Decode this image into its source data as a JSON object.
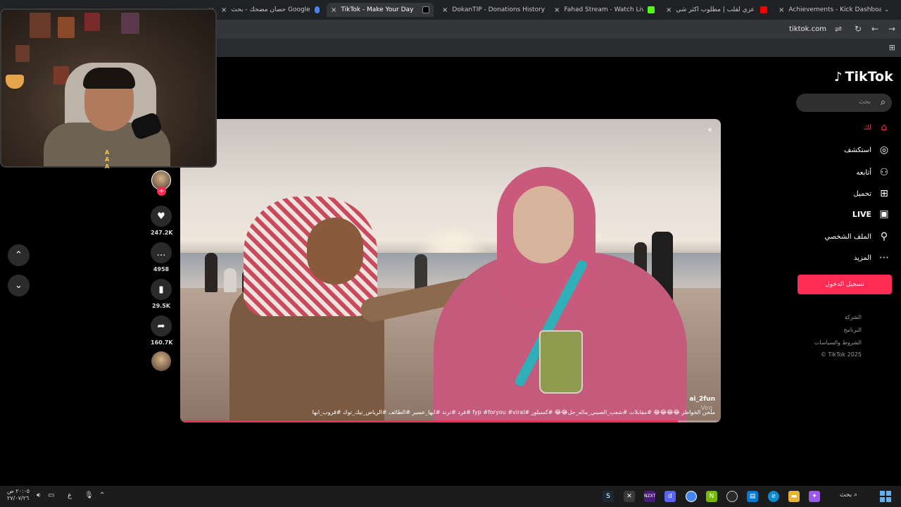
{
  "browser": {
    "tabs": [
      {
        "label": "حصان مضحك - بحث Google",
        "favicon_color": "#4285f4"
      },
      {
        "label": "TikTok - Make Your Day",
        "favicon_color": "#000000",
        "active": true
      },
      {
        "label": "DokanTIP - Donations History",
        "favicon_color": "#d08a3a"
      },
      {
        "label": "Fahad Stream - Watch Live on K",
        "favicon_color": "#53fc18"
      },
      {
        "label": "عزي لقلب | مطلوب اكثر شي -",
        "favicon_color": "#ff0000"
      },
      {
        "label": "Achievements - Kick Dashboard",
        "favicon_color": "#53fc18"
      }
    ],
    "url": "tiktok.com",
    "nav_icons": [
      "tune-icon",
      "reload-icon",
      "back-icon",
      "forward-icon"
    ]
  },
  "tiktok": {
    "logo": "TikTok",
    "search_placeholder": "بحث",
    "nav": [
      {
        "label": "لك",
        "icon": "home-icon",
        "active": true
      },
      {
        "label": "استكشف",
        "icon": "compass-icon"
      },
      {
        "label": "أتابعه",
        "icon": "following-icon"
      },
      {
        "label": "تحميل",
        "icon": "upload-icon"
      },
      {
        "label": "LIVE",
        "icon": "live-icon"
      },
      {
        "label": "الملف الشخصي",
        "icon": "profile-icon"
      },
      {
        "label": "المزيد",
        "icon": "more-icon"
      }
    ],
    "login_label": "تسجيل الدخول",
    "footer": [
      "الشركة",
      "البرنامج",
      "الشروط والسياسات",
      "© TikTok 2025"
    ]
  },
  "video": {
    "author": "ai_2fun",
    "watermark": "Veo",
    "caption": "ملحن الخواطر 😂😂😂😂 #مقابلات #شعب_الصيني_ماله_حل😂😂 #كسبلور #fyp #foryou #viral #قرد #ترند #ابها_عسير #الطائف #الرياض_تيك_توك #قروب_ابها",
    "progress_fraction": 0.92,
    "mute_icon": "volume-muted-icon"
  },
  "actions": {
    "likes": "247.2K",
    "comments": "4958",
    "saves": "29.5K",
    "shares": "160.7K"
  },
  "webcam_overlay_text": "A\nA\nA",
  "taskbar": {
    "clock_time": "٢٠:٠٥ ص",
    "clock_date": "٢٧/٠٧/٢٦",
    "lang": "ع",
    "search_label": "بحث"
  }
}
